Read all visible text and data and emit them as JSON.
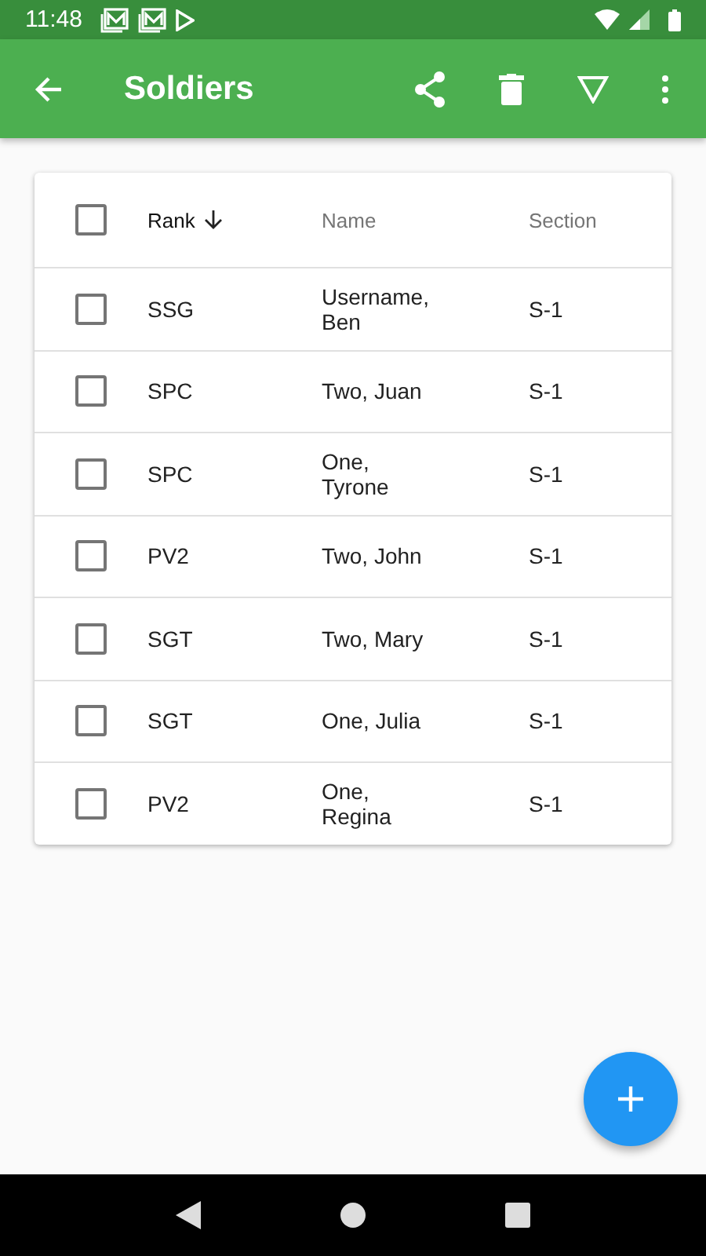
{
  "status_bar": {
    "time": "11:48"
  },
  "app_bar": {
    "title": "Soldiers"
  },
  "table": {
    "select_all": {
      "checked": false
    },
    "columns": [
      {
        "label": "Rank",
        "sorted": true
      },
      {
        "label": "Name",
        "sorted": false
      },
      {
        "label": "Section",
        "sorted": false
      }
    ],
    "rows": [
      {
        "checked": false,
        "rank": "SSG",
        "name": "Username, Ben",
        "section": "S-1"
      },
      {
        "checked": false,
        "rank": "SPC",
        "name": "Two, Juan",
        "section": "S-1"
      },
      {
        "checked": false,
        "rank": "SPC",
        "name": "One, Tyrone",
        "section": "S-1"
      },
      {
        "checked": false,
        "rank": "PV2",
        "name": "Two, John",
        "section": "S-1"
      },
      {
        "checked": false,
        "rank": "SGT",
        "name": "Two, Mary",
        "section": "S-1"
      },
      {
        "checked": false,
        "rank": "SGT",
        "name": "One, Julia",
        "section": "S-1"
      },
      {
        "checked": false,
        "rank": "PV2",
        "name": "One, Regina",
        "section": "S-1"
      }
    ]
  }
}
